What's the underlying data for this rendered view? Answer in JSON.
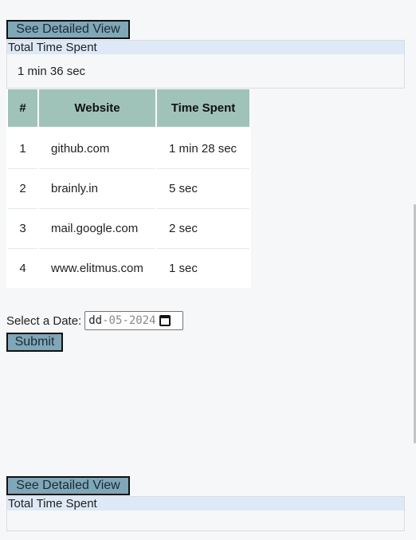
{
  "top": {
    "detail_button": "See Detailed View",
    "summary_title": "Total Time Spent",
    "summary_value": "1 min 36 sec"
  },
  "table": {
    "headers": [
      "#",
      "Website",
      "Time Spent"
    ],
    "rows": [
      [
        "1",
        "github.com",
        "1 min 28 sec"
      ],
      [
        "2",
        "brainly.in",
        "5 sec"
      ],
      [
        "3",
        "mail.google.com",
        "2 sec"
      ],
      [
        "4",
        "www.elitmus.com",
        "1 sec"
      ]
    ]
  },
  "date_form": {
    "label": "Select a Date:",
    "value_day": "dd",
    "value_month": "05",
    "value_year": "2024",
    "submit": "Submit"
  },
  "bottom": {
    "detail_button": "See Detailed View",
    "summary_title": "Total Time Spent",
    "summary_value": ""
  },
  "colors": {
    "button_bg": "#7ea7b8",
    "header_bg": "#9fc3b8",
    "summary_head_bg": "#dde9f6",
    "page_bg": "#f6f7f9"
  }
}
